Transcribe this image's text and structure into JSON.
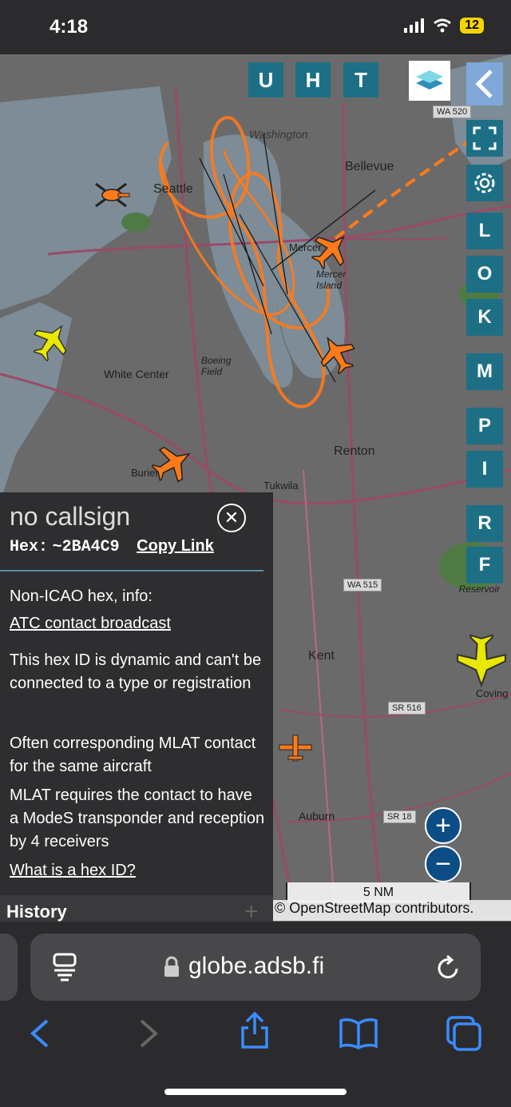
{
  "status": {
    "time": "4:18",
    "battery": "12"
  },
  "map": {
    "labels": [
      "Washington",
      "Seattle",
      "Bellevue",
      "Mercer Island",
      "Mercer",
      "White Center",
      "Boeing Field",
      "Renton",
      "Burien",
      "Tukwila",
      "Kent",
      "Auburn",
      "Lake Reservoir",
      "Coving"
    ],
    "road_shields": [
      "WA 520",
      "WA 515",
      "SR 516",
      "SR 18"
    ],
    "scale": "5 NM",
    "attribution": "© OpenStreetMap contributors."
  },
  "toolbar": {
    "top": [
      "U",
      "H",
      "T"
    ],
    "side": [
      "L",
      "O",
      "K",
      "M",
      "P",
      "I",
      "R",
      "F"
    ]
  },
  "panel": {
    "callsign": "no callsign",
    "hex_label": "Hex:",
    "hex_value": "~2BA4C9",
    "copy_link": "Copy Link",
    "line1": "Non-ICAO hex, info:",
    "link1": "ATC contact broadcast",
    "para1": "This hex ID is dynamic and can't be connected to a type or registration",
    "para2": "Often corresponding MLAT contact for the same aircraft",
    "para3": "MLAT requires the contact to have a ModeS transponder and reception by 4 receivers",
    "link2": "What is a hex ID?",
    "history": "History"
  },
  "browser": {
    "url": "globe.adsb.fi"
  },
  "colors": {
    "accent": "#1d6f86",
    "track": "#ff7a1a",
    "aircraft_yellow": "#e8e800"
  }
}
